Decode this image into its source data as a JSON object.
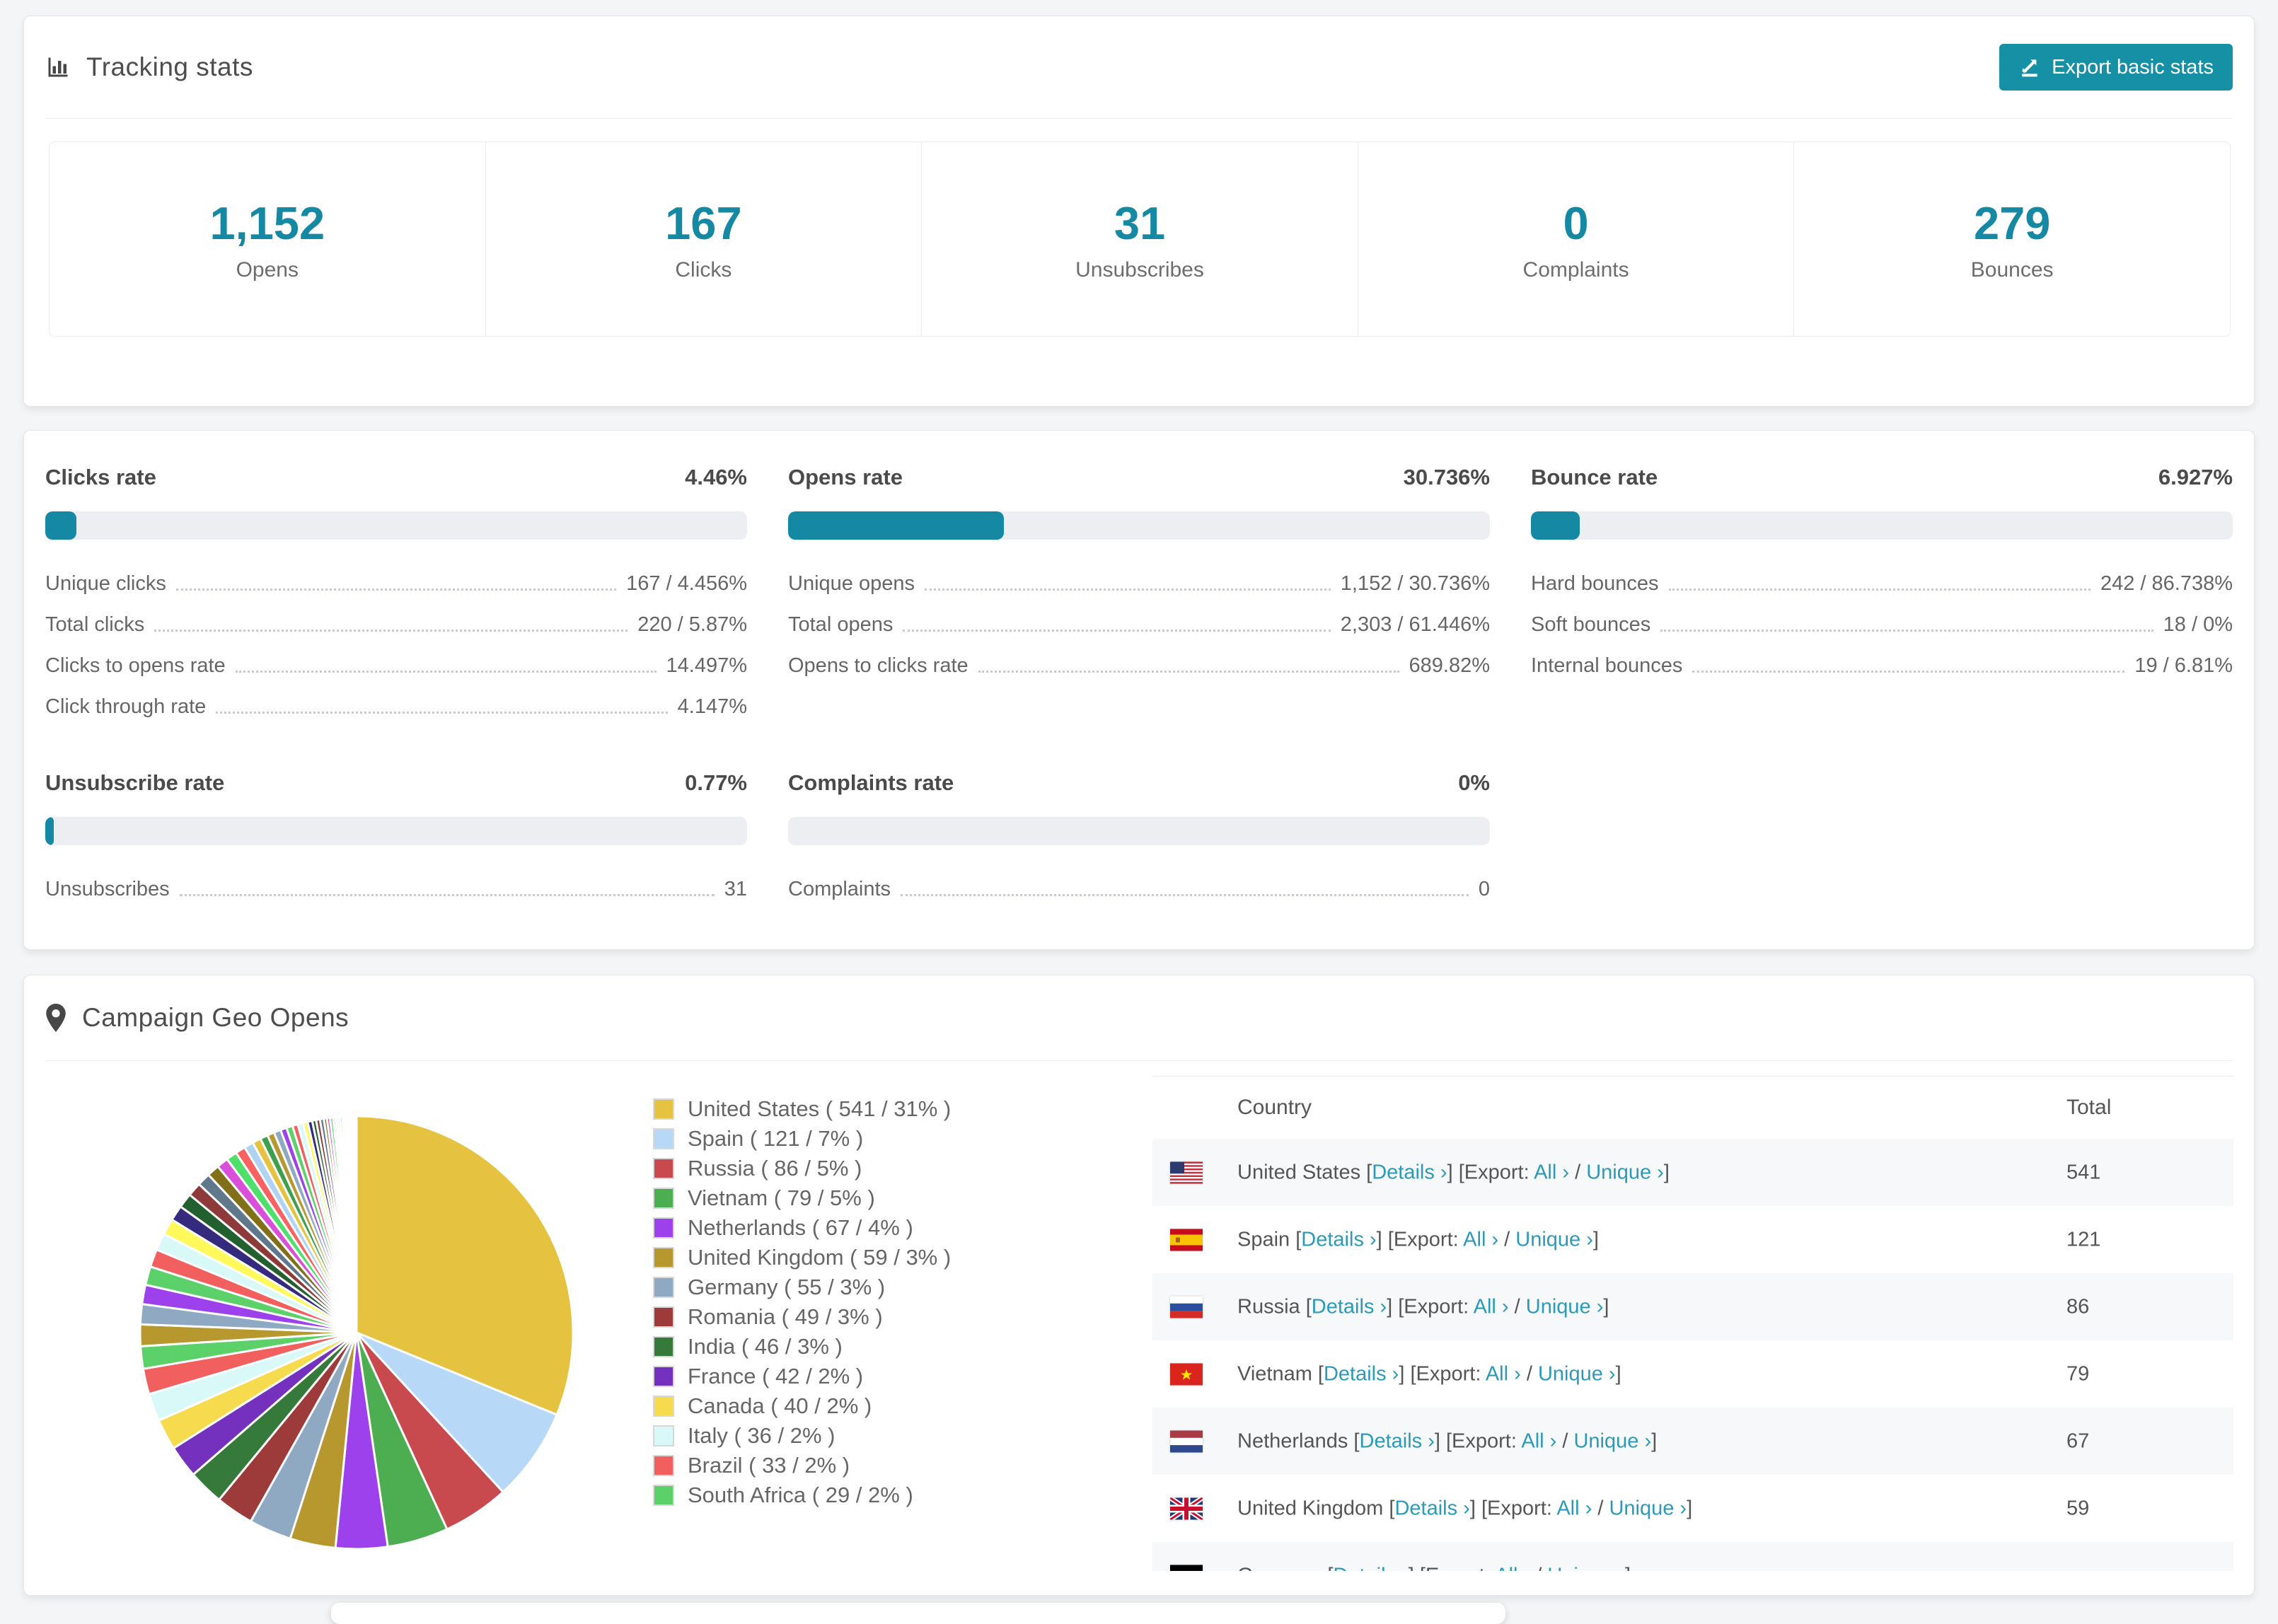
{
  "page": {
    "background": "#f4f5f7",
    "accent_teal": "#1589A3",
    "link_color": "#2B9AB8"
  },
  "tracking": {
    "title": "Tracking stats",
    "export_button": "Export basic stats",
    "stats": [
      {
        "value": "1,152",
        "label": "Opens"
      },
      {
        "value": "167",
        "label": "Clicks"
      },
      {
        "value": "31",
        "label": "Unsubscribes"
      },
      {
        "value": "0",
        "label": "Complaints"
      },
      {
        "value": "279",
        "label": "Bounces"
      }
    ]
  },
  "rates": {
    "sections": [
      {
        "title": "Clicks rate",
        "value": "4.46%",
        "percent": 4.46,
        "rows": [
          {
            "label": "Unique clicks",
            "value": "167 / 4.456%"
          },
          {
            "label": "Total clicks",
            "value": "220 / 5.87%"
          },
          {
            "label": "Clicks to opens rate",
            "value": "14.497%"
          },
          {
            "label": "Click through rate",
            "value": "4.147%"
          }
        ]
      },
      {
        "title": "Opens rate",
        "value": "30.736%",
        "percent": 30.736,
        "rows": [
          {
            "label": "Unique opens",
            "value": "1,152 / 30.736%"
          },
          {
            "label": "Total opens",
            "value": "2,303 / 61.446%"
          },
          {
            "label": "Opens to clicks rate",
            "value": "689.82%"
          }
        ]
      },
      {
        "title": "Bounce rate",
        "value": "6.927%",
        "percent": 6.927,
        "rows": [
          {
            "label": "Hard bounces",
            "value": "242 / 86.738%"
          },
          {
            "label": "Soft bounces",
            "value": "18 / 0%"
          },
          {
            "label": "Internal bounces",
            "value": "19 / 6.81%"
          }
        ]
      },
      {
        "title": "Unsubscribe rate",
        "value": "0.77%",
        "percent": 0.77,
        "rows": [
          {
            "label": "Unsubscribes",
            "value": "31"
          }
        ]
      },
      {
        "title": "Complaints rate",
        "value": "0%",
        "percent": 0,
        "rows": [
          {
            "label": "Complaints",
            "value": "0"
          }
        ]
      }
    ]
  },
  "geo": {
    "title": "Campaign Geo Opens",
    "table": {
      "columns": [
        "Country",
        "Total"
      ],
      "labels": {
        "details": "Details ›",
        "export": "Export:",
        "all": "All ›",
        "unique": "Unique ›"
      },
      "rows": [
        {
          "country": "United States",
          "flag": "us",
          "total": "541"
        },
        {
          "country": "Spain",
          "flag": "es",
          "total": "121"
        },
        {
          "country": "Russia",
          "flag": "ru",
          "total": "86"
        },
        {
          "country": "Vietnam",
          "flag": "vn",
          "total": "79"
        },
        {
          "country": "Netherlands",
          "flag": "nl",
          "total": "67"
        },
        {
          "country": "United Kingdom",
          "flag": "gb",
          "total": "59"
        },
        {
          "country": "Germany",
          "flag": "de",
          "total": "",
          "partial": true
        }
      ]
    }
  },
  "chart_data": {
    "type": "pie",
    "title": "Campaign Geo Opens",
    "legend_position": "right",
    "start_angle_deg": 0,
    "direction": "clockwise",
    "series": [
      {
        "name": "United States",
        "value": 541,
        "percent": "31%",
        "color": "#E5C23F",
        "legend": "United States ( 541 / 31% )"
      },
      {
        "name": "Spain",
        "value": 121,
        "percent": "7%",
        "color": "#B7D8F6",
        "legend": "Spain ( 121 / 7% )"
      },
      {
        "name": "Russia",
        "value": 86,
        "percent": "5%",
        "color": "#C94A4E",
        "legend": "Russia ( 86 / 5% )"
      },
      {
        "name": "Vietnam",
        "value": 79,
        "percent": "5%",
        "color": "#4CAE50",
        "legend": "Vietnam ( 79 / 5% )"
      },
      {
        "name": "Netherlands",
        "value": 67,
        "percent": "4%",
        "color": "#9C41EC",
        "legend": "Netherlands ( 67 / 4% )"
      },
      {
        "name": "United Kingdom",
        "value": 59,
        "percent": "3%",
        "color": "#B6982F",
        "legend": "United Kingdom ( 59 / 3% )"
      },
      {
        "name": "Germany",
        "value": 55,
        "percent": "3%",
        "color": "#8FA9C2",
        "legend": "Germany ( 55 / 3% )"
      },
      {
        "name": "Romania",
        "value": 49,
        "percent": "3%",
        "color": "#9D3B3B",
        "legend": "Romania ( 49 / 3% )"
      },
      {
        "name": "India",
        "value": 46,
        "percent": "3%",
        "color": "#367A3B",
        "legend": "India ( 46 / 3% )"
      },
      {
        "name": "France",
        "value": 42,
        "percent": "2%",
        "color": "#7431BE",
        "legend": "France ( 42 / 2% )"
      },
      {
        "name": "Canada",
        "value": 40,
        "percent": "2%",
        "color": "#F6DB4F",
        "legend": "Canada ( 40 / 2% )"
      },
      {
        "name": "Italy",
        "value": 36,
        "percent": "2%",
        "color": "#D9F8F8",
        "legend": "Italy ( 36 / 2% )"
      },
      {
        "name": "Brazil",
        "value": 33,
        "percent": "2%",
        "color": "#F25F5F",
        "legend": "Brazil ( 33 / 2% )"
      },
      {
        "name": "South Africa",
        "value": 29,
        "percent": "2%",
        "color": "#5CD169",
        "legend": "South Africa ( 29 / 2% )"
      }
    ],
    "other_slices": [
      28,
      26,
      25,
      24,
      23,
      22,
      21,
      20,
      19,
      18,
      17,
      16,
      15,
      14,
      13,
      12,
      11,
      10,
      9,
      9,
      8,
      8,
      7,
      7,
      6,
      6,
      5,
      5,
      5,
      4,
      4,
      4,
      3,
      3,
      3,
      3,
      2,
      2,
      2,
      2,
      2,
      2,
      1,
      1,
      1,
      1,
      1,
      1
    ],
    "other_colors": [
      "#B6982F",
      "#8FA9C2",
      "#9C41EC",
      "#5CD169",
      "#F25F5F",
      "#D9F8F8",
      "#FFF95C",
      "#352B7E",
      "#236030",
      "#8E3A3A",
      "#60788C",
      "#827018",
      "#D94FD9",
      "#4FE06B",
      "#FA6161",
      "#AFD3F2",
      "#E5C23F",
      "#3BA14C"
    ]
  }
}
